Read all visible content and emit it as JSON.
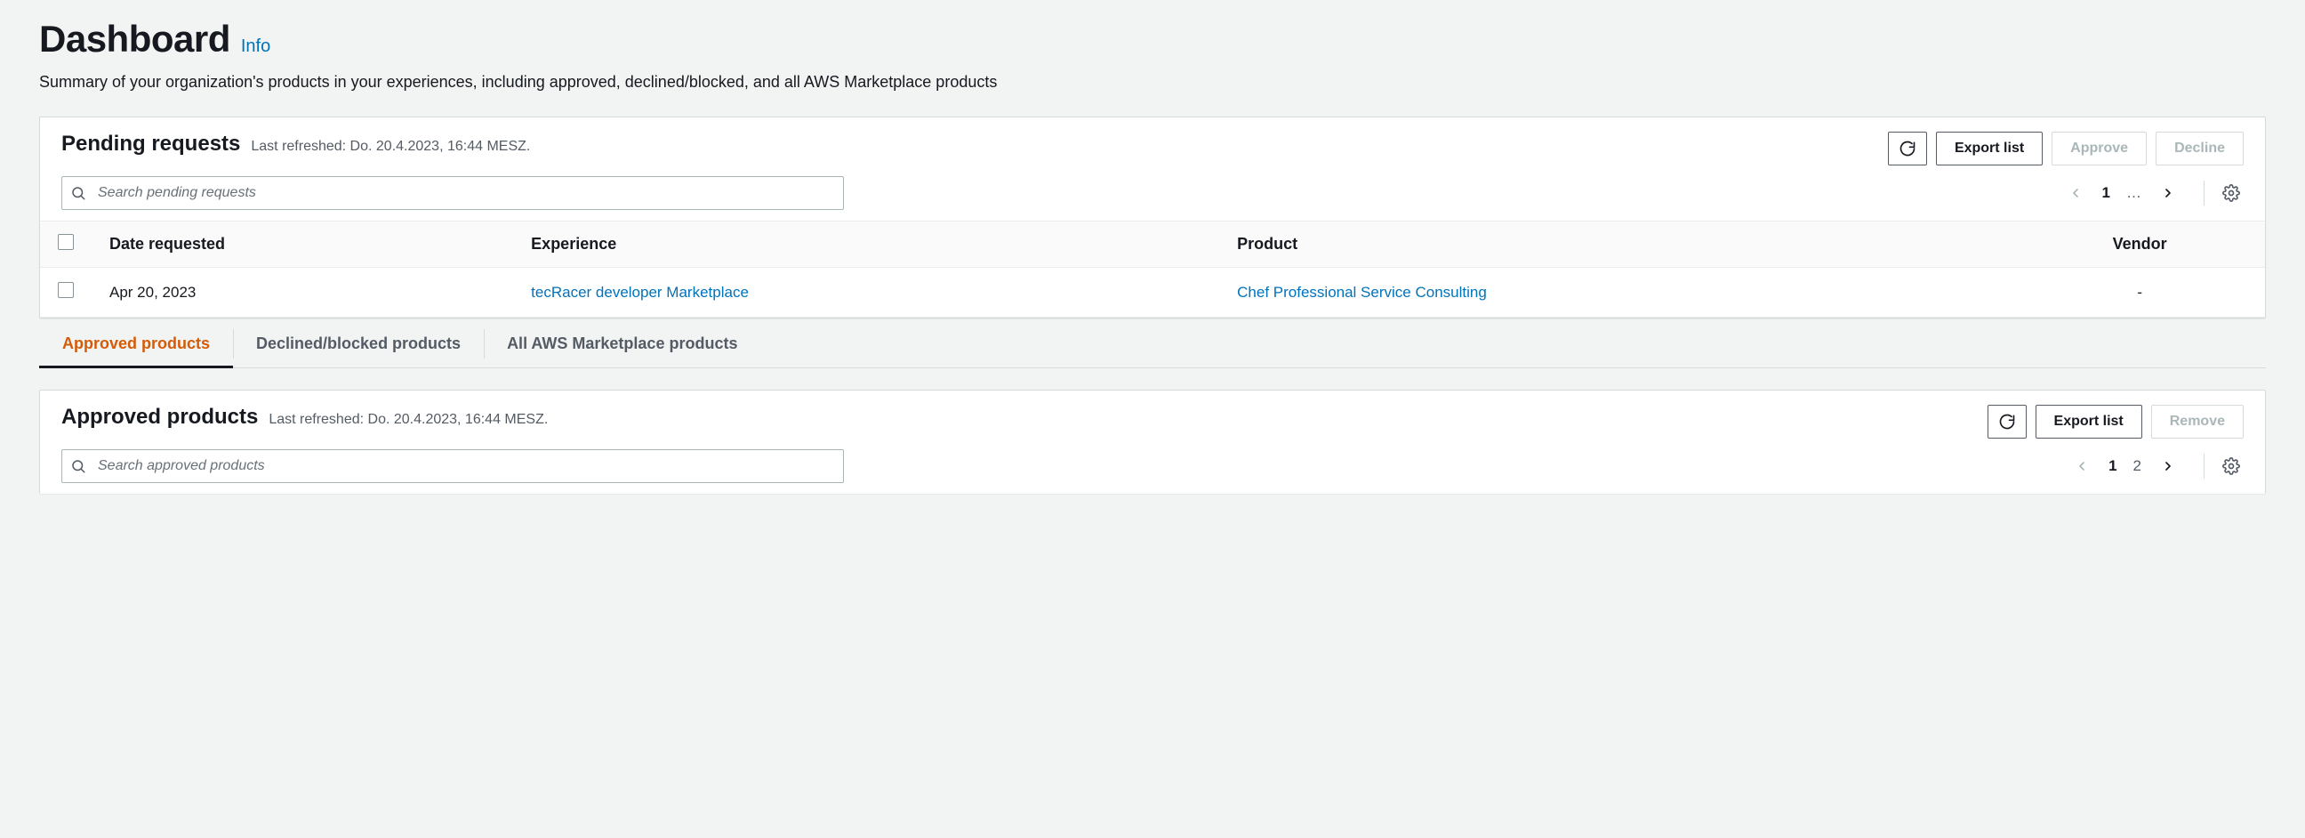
{
  "header": {
    "title": "Dashboard",
    "info_label": "Info",
    "subtitle": "Summary of your organization's products in your experiences, including approved, declined/blocked, and all AWS Marketplace products"
  },
  "pending": {
    "title": "Pending requests",
    "refreshed": "Last refreshed: Do. 20.4.2023, 16:44 MESZ.",
    "actions": {
      "refresh": "Refresh",
      "export": "Export list",
      "approve": "Approve",
      "decline": "Decline"
    },
    "search_placeholder": "Search pending requests",
    "pager": {
      "page": "1",
      "ellipsis": "…"
    },
    "columns": [
      "Date requested",
      "Experience",
      "Product",
      "Vendor"
    ],
    "rows": [
      {
        "date": "Apr 20, 2023",
        "experience": "tecRacer developer Marketplace",
        "product": "Chef Professional Service Consulting",
        "vendor": "-"
      }
    ]
  },
  "tabs": {
    "approved": "Approved products",
    "declined": "Declined/blocked products",
    "all": "All AWS Marketplace products"
  },
  "approved": {
    "title": "Approved products",
    "refreshed": "Last refreshed: Do. 20.4.2023, 16:44 MESZ.",
    "actions": {
      "refresh": "Refresh",
      "export": "Export list",
      "remove": "Remove"
    },
    "search_placeholder": "Search approved products",
    "pager": {
      "p1": "1",
      "p2": "2"
    }
  }
}
